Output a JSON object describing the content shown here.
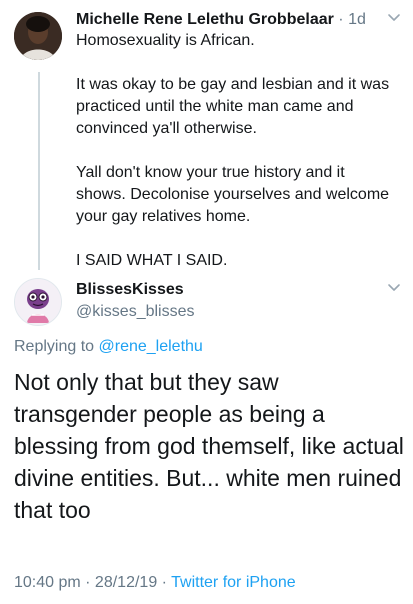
{
  "original_tweet": {
    "author_name": "Michelle Rene Lelethu Grobbelaar",
    "separator": "·",
    "time_ago": "1d",
    "paragraphs": [
      "Homosexuality is African.",
      "It was okay to be gay and lesbian and it was practiced until the white man came and convinced ya'll otherwise.",
      "Yall don't know your true history and it shows. Decolonise yourselves and welcome your gay relatives home.",
      "I SAID WHAT I SAID."
    ]
  },
  "reply_tweet": {
    "author_name": "BlissesKisses",
    "handle": "@kisses_blisses",
    "replying_prefix": "Replying to",
    "replying_handle": "@rene_lelethu",
    "text": "Not only that but they saw transgender people as being a blessing from god themself, like actual divine entities. But... white men ruined that too",
    "timestamp": "10:40 pm · 28/12/19 ·",
    "source": "Twitter for iPhone"
  },
  "icons": {
    "caret": "chevron-down-icon",
    "avatar_first": "profile-photo",
    "avatar_second": "cartoon-avatar"
  }
}
